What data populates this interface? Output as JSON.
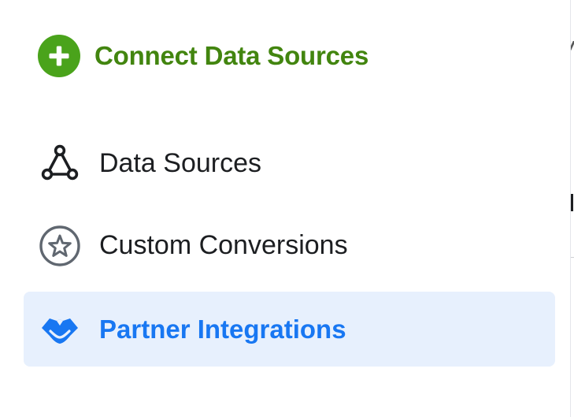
{
  "header": {
    "connect_label": "Connect Data Sources",
    "connect_icon": "plus-circle-icon"
  },
  "nav": {
    "items": [
      {
        "label": "Data Sources",
        "icon": "triangle-nodes-icon",
        "active": false
      },
      {
        "label": "Custom Conversions",
        "icon": "star-circle-icon",
        "active": false
      },
      {
        "label": "Partner Integrations",
        "icon": "handshake-icon",
        "active": true
      }
    ]
  },
  "colors": {
    "connect_green": "#42850f",
    "plus_circle_green": "#4aa31b",
    "active_blue": "#1877f2",
    "active_bg": "#e7f0fd",
    "text_dark": "#1c1e21",
    "icon_gray": "#606770"
  }
}
